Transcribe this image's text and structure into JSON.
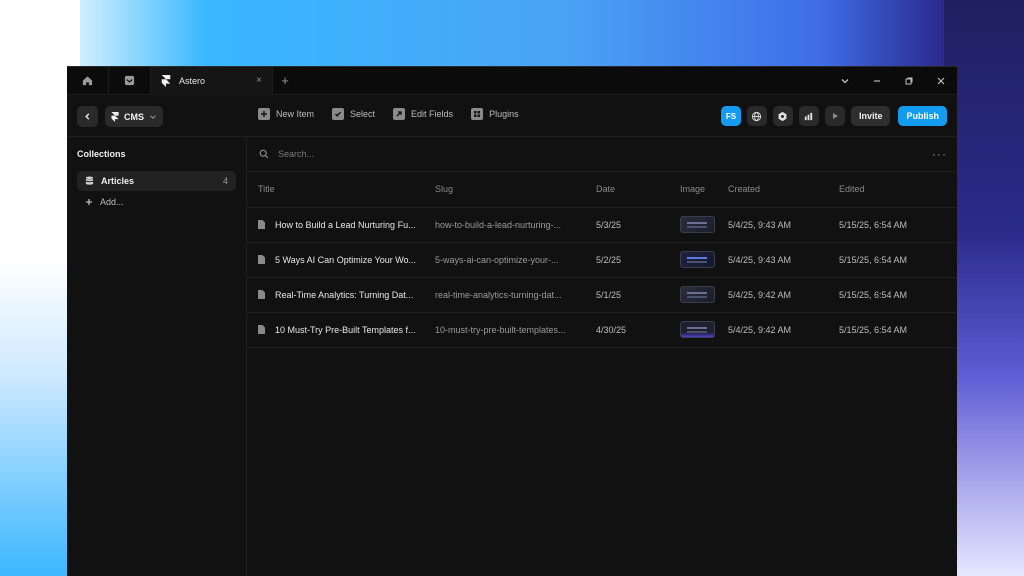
{
  "titlebar": {
    "tab": {
      "title": "Astero",
      "close": "×"
    },
    "add_tab": "+",
    "controls": {
      "dropdown": "⌄",
      "minimize": "–",
      "restore": "❐",
      "close": "✕"
    }
  },
  "toolbar": {
    "section_label": "CMS",
    "actions": [
      {
        "label": "New Item",
        "icon": "plus-icon"
      },
      {
        "label": "Select",
        "icon": "check-icon"
      },
      {
        "label": "Edit Fields",
        "icon": "arrow-up-right-icon"
      },
      {
        "label": "Plugins",
        "icon": "grid-icon"
      }
    ],
    "avatar": "FS",
    "invite_label": "Invite",
    "publish_label": "Publish"
  },
  "sidebar": {
    "heading": "Collections",
    "items": [
      {
        "label": "Articles",
        "count": "4"
      }
    ],
    "add_label": "Add..."
  },
  "search": {
    "placeholder": "Search..."
  },
  "table": {
    "columns": {
      "title": "Title",
      "slug": "Slug",
      "date": "Date",
      "image": "Image",
      "created": "Created",
      "edited": "Edited"
    },
    "rows": [
      {
        "title": "How to Build a Lead Nurturing Fu...",
        "slug": "how-to-build-a-lead-nurturing-...",
        "date": "5/3/25",
        "created": "5/4/25, 9:43 AM",
        "edited": "5/15/25, 6:54 AM"
      },
      {
        "title": "5 Ways AI Can Optimize Your Wo...",
        "slug": "5-ways-ai-can-optimize-your-...",
        "date": "5/2/25",
        "created": "5/4/25, 9:43 AM",
        "edited": "5/15/25, 6:54 AM"
      },
      {
        "title": "Real-Time Analytics: Turning Dat...",
        "slug": "real-time-analytics-turning-dat...",
        "date": "5/1/25",
        "created": "5/4/25, 9:42 AM",
        "edited": "5/15/25, 6:54 AM"
      },
      {
        "title": "10 Must-Try Pre-Built Templates f...",
        "slug": "10-must-try-pre-built-templates...",
        "date": "4/30/25",
        "created": "5/4/25, 9:42 AM",
        "edited": "5/15/25, 6:54 AM"
      }
    ]
  },
  "colors": {
    "accent": "#139bef",
    "window_bg": "#111111"
  }
}
